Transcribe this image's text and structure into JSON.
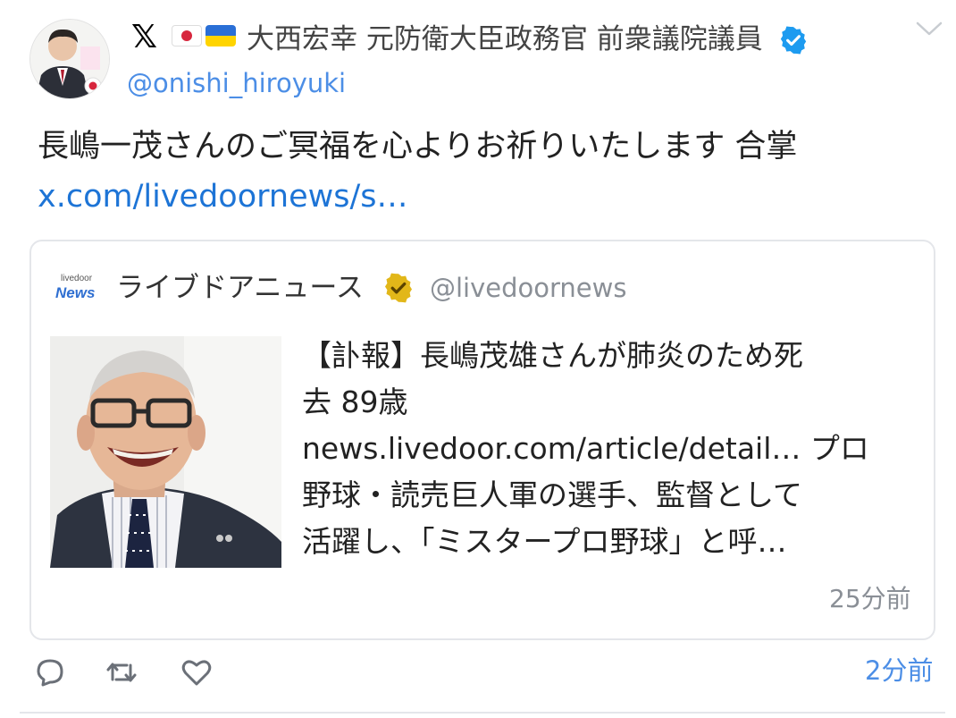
{
  "tweet": {
    "author": {
      "display_name": "大西宏幸 元防衛大臣政務官 前衆議院議員",
      "handle": "@onishi_hiroyuki",
      "badge_icon": "verified-blue-icon",
      "flag_icons": [
        "japan-flag-icon",
        "ukraine-flag-icon"
      ],
      "platform_icon": "x-logo-icon",
      "avatar_caption": "大西宏幸"
    },
    "text": "長嶋一茂さんのご冥福を心よりお祈りいたします 合掌",
    "link_text": "x.com/livedoornews/s…",
    "timestamp": "2分前",
    "colors": {
      "link": "#1d74d6",
      "handle": "#4c8ee6",
      "verified": "#1d9bf0"
    }
  },
  "quoted": {
    "logo_top": "livedoor",
    "logo_bottom": "News",
    "name": "ライブドアニュース",
    "handle": "@livedoornews",
    "badge_icon": "verified-gold-icon",
    "body_lines": [
      "【訃報】長嶋茂雄さんが肺炎のため死",
      "去 89歳",
      "news.livedoor.com/article/detail… プロ",
      "野球・読売巨人軍の選手、監督として",
      "活躍し、「ミスタープロ野球」と呼…"
    ],
    "timestamp": "25分前",
    "colors": {
      "verified": "#e2b719"
    }
  },
  "actions": [
    {
      "name": "reply-icon"
    },
    {
      "name": "retweet-icon"
    },
    {
      "name": "like-icon"
    }
  ]
}
